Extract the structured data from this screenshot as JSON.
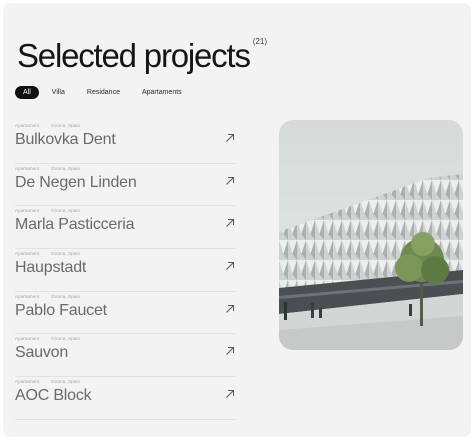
{
  "header": {
    "title": "Selected projects",
    "count": "(21)"
  },
  "filters": [
    {
      "label": "All",
      "active": true
    },
    {
      "label": "Villa",
      "active": false
    },
    {
      "label": "Residance",
      "active": false
    },
    {
      "label": "Apartaments",
      "active": false
    }
  ],
  "projects": [
    {
      "type": "Apartament",
      "location": "Girona, Spain",
      "name": "Bulkovka Dent",
      "icon": "arrow-up-right-icon"
    },
    {
      "type": "Apartament",
      "location": "Girona, Spain",
      "name": "De Negen Linden",
      "icon": "arrow-up-right-icon"
    },
    {
      "type": "Apartament",
      "location": "Girona, Spain",
      "name": "Marla Pasticceria",
      "icon": "arrow-up-right-icon"
    },
    {
      "type": "Apartament",
      "location": "Girona, Spain",
      "name": "Haupstadt",
      "icon": "arrow-up-right-icon"
    },
    {
      "type": "Apartament",
      "location": "Girona, Spain",
      "name": "Pablo Faucet",
      "icon": "arrow-up-right-icon"
    },
    {
      "type": "Apartament",
      "location": "Girona, Spain",
      "name": "Sauvon",
      "icon": "arrow-up-right-icon"
    },
    {
      "type": "Apartament",
      "location": "Girona, Spain",
      "name": "AOC Block",
      "icon": "arrow-up-right-icon"
    }
  ],
  "colors": {
    "background": "#f3f3f3",
    "accent": "#111111",
    "project_name": "#6a6a6a",
    "meta": "#a4a4a4"
  }
}
